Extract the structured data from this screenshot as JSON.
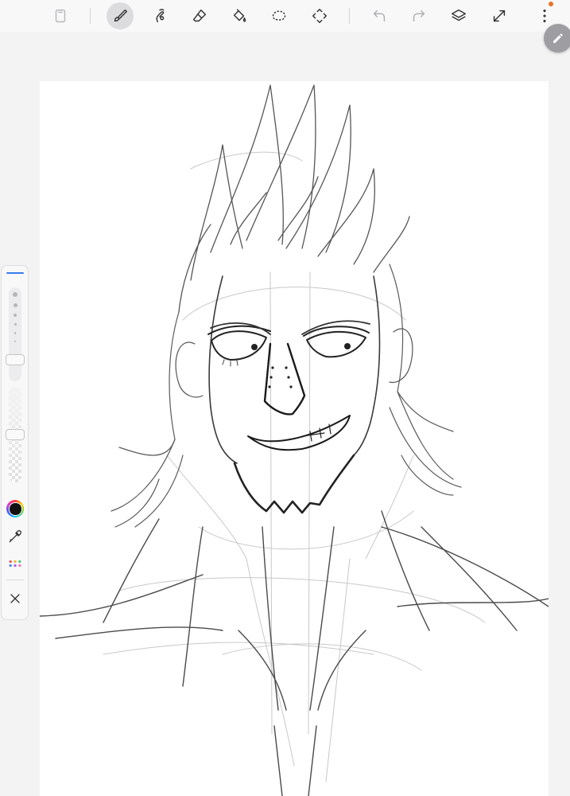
{
  "app": {
    "accent_color": "#3a7be8",
    "notification_color": "#e8742a",
    "current_color": "#111111"
  },
  "toolbar": {
    "left_tools": [
      {
        "id": "save",
        "icon": "save-icon"
      },
      {
        "id": "brush",
        "icon": "brush-icon",
        "active": true
      },
      {
        "id": "smudge",
        "icon": "smudge-icon"
      },
      {
        "id": "eraser",
        "icon": "eraser-icon"
      },
      {
        "id": "fill",
        "icon": "paint-bucket-icon"
      },
      {
        "id": "lasso",
        "icon": "lasso-icon"
      },
      {
        "id": "transform",
        "icon": "transform-icon"
      }
    ],
    "right_tools": [
      {
        "id": "undo",
        "icon": "undo-icon",
        "disabled": true
      },
      {
        "id": "redo",
        "icon": "redo-icon",
        "disabled": true
      },
      {
        "id": "layers",
        "icon": "layers-icon"
      },
      {
        "id": "fullscreen",
        "icon": "expand-icon"
      },
      {
        "id": "more",
        "icon": "more-vertical-icon",
        "has_notification": true
      }
    ]
  },
  "floating_button": {
    "icon": "pencil-icon"
  },
  "side_panel": {
    "brush_size_level": 0.65,
    "opacity_level": 0.45,
    "tools": [
      "color-wheel-icon",
      "eyedropper-icon",
      "palette-icon",
      "close-icon"
    ]
  },
  "canvas": {
    "content": "pencil sketch"
  }
}
